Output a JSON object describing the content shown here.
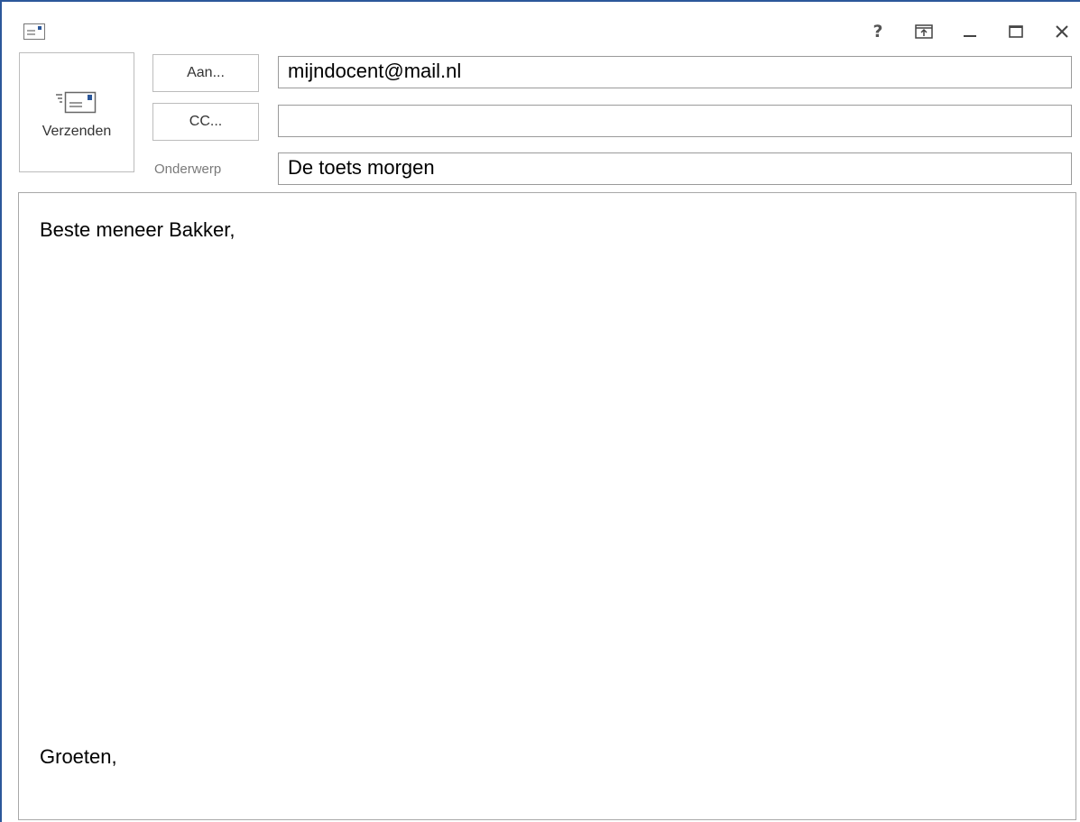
{
  "window": {
    "controls": {
      "help": "?",
      "ribbon_icon": "ribbon-display-options-icon",
      "minimize_icon": "minimize-icon",
      "maximize_icon": "maximize-icon",
      "close_icon": "close-icon"
    },
    "app_icon": "message-icon"
  },
  "toolbar": {
    "send_label": "Verzenden",
    "send_icon": "send-envelope-icon"
  },
  "header": {
    "to_button_label": "Aan...",
    "cc_button_label": "CC...",
    "subject_label": "Onderwerp",
    "to_value": "mijndocent@mail.nl",
    "cc_value": "",
    "subject_value": "De toets morgen"
  },
  "body": {
    "greeting": "Beste meneer Bakker,",
    "closing": "Groeten,"
  },
  "colors": {
    "window_border": "#2b579a",
    "control_border": "#bcbcbc",
    "field_border": "#9a9a9a"
  }
}
